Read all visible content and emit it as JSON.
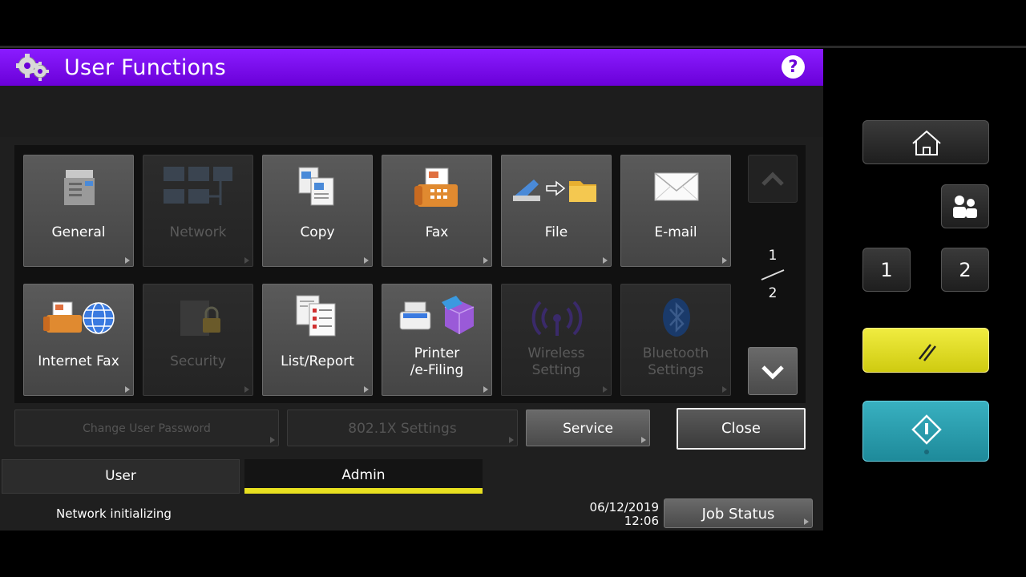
{
  "window": {
    "title": "User Functions",
    "help_label": "?"
  },
  "tiles": [
    {
      "label": "General",
      "enabled": true
    },
    {
      "label": "Network",
      "enabled": false
    },
    {
      "label": "Copy",
      "enabled": true
    },
    {
      "label": "Fax",
      "enabled": true
    },
    {
      "label": "File",
      "enabled": true
    },
    {
      "label": "E-mail",
      "enabled": true
    },
    {
      "label": "Internet Fax",
      "enabled": true
    },
    {
      "label": "Security",
      "enabled": false
    },
    {
      "label": "List/Report",
      "enabled": true
    },
    {
      "label_line1": "Printer",
      "label_line2": "/e-Filing",
      "enabled": true
    },
    {
      "label_line1": "Wireless",
      "label_line2": "Setting",
      "enabled": false
    },
    {
      "label_line1": "Bluetooth",
      "label_line2": "Settings",
      "enabled": false
    }
  ],
  "pager": {
    "current": "1",
    "total": "2"
  },
  "actions": {
    "change_password": "Change User Password",
    "dot1x": "802.1X Settings",
    "service": "Service",
    "close": "Close"
  },
  "tabs": [
    {
      "label": "User",
      "active": false
    },
    {
      "label": "Admin",
      "active": true
    }
  ],
  "status": {
    "message": "Network initializing",
    "date": "06/12/2019",
    "time": "12:06",
    "job_status": "Job Status"
  },
  "hardware": {
    "num1": "1",
    "num2": "2"
  },
  "colors": {
    "title_bar": "#7a0cf0",
    "active_tab": "#e8e020",
    "clear_key": "#e4e021",
    "start_key": "#2a9fb0"
  }
}
